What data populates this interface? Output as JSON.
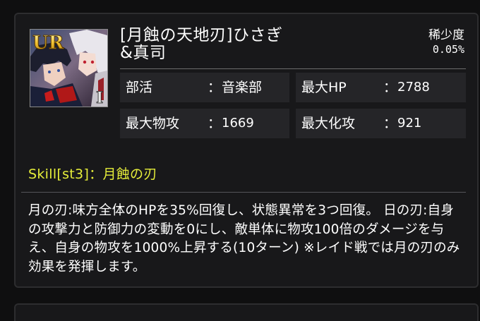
{
  "card": {
    "rank_badge": "UR",
    "name": "[月蝕の天地刃]ひさぎ\n&真司",
    "rarity": {
      "label": "稀少度",
      "value": "0.05%"
    },
    "portrait_icon": "character-portrait-icon"
  },
  "stats": [
    {
      "label": "部活",
      "value": "音楽部"
    },
    {
      "label": "最大HP",
      "value": "2788"
    },
    {
      "label": "最大物攻",
      "value": "1669"
    },
    {
      "label": "最大化攻",
      "value": "921"
    }
  ],
  "separator": "：",
  "skill": {
    "title": "Skill[st3]：月蝕の刃",
    "title_color": "#e6ee3a",
    "description": "月の刃:味方全体のHPを35%回復し、状態異常を3つ回復。 日の刃:自身の攻撃力と防御力の変動を0にし、敵単体に物攻100倍のダメージを与え、自身の物攻を1000%上昇する(10ターン) ※レイド戦では月の刃のみ効果を発揮します。"
  },
  "colors": {
    "panel_bg": "#18181a",
    "stat_bg": "#252528",
    "border": "#2d2d2f"
  }
}
